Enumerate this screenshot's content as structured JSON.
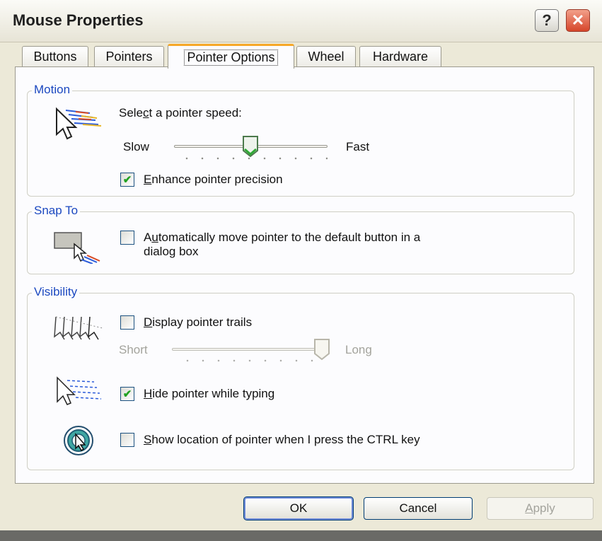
{
  "window": {
    "title": "Mouse Properties",
    "help_glyph": "?",
    "close_glyph": "✕"
  },
  "tabs": [
    {
      "label": "Buttons"
    },
    {
      "label": "Pointers"
    },
    {
      "label": "Pointer Options",
      "active": true
    },
    {
      "label": "Wheel"
    },
    {
      "label": "Hardware"
    }
  ],
  "motion": {
    "group_label": "Motion",
    "speed_label_a": "Sele",
    "speed_label_u": "c",
    "speed_label_b": "t a pointer speed:",
    "slow_label": "Slow",
    "fast_label": "Fast",
    "speed_level": 0.5,
    "precision_checked": true,
    "precision_u": "E",
    "precision_rest": "nhance pointer precision"
  },
  "snap": {
    "group_label": "Snap To",
    "checked": false,
    "label_a": "A",
    "label_u": "u",
    "label_b": "tomatically move pointer to the default button in a",
    "label_line2": "dialog box"
  },
  "visibility": {
    "group_label": "Visibility",
    "trails_checked": false,
    "trails_u": "D",
    "trails_rest": "isplay pointer trails",
    "short_label": "Short",
    "long_label": "Long",
    "trail_level": 1.0,
    "hide_checked": true,
    "hide_u": "H",
    "hide_rest": "ide pointer while typing",
    "show_checked": false,
    "show_u": "S",
    "show_rest": "how location of pointer when I press the CTRL key"
  },
  "buttons": {
    "ok": "OK",
    "cancel": "Cancel",
    "apply_u": "A",
    "apply_rest": "pply"
  },
  "colors": {
    "group_label": "#1b48c0",
    "tab_highlight": "#f6a828",
    "check": "#21a121",
    "close": "#d6452a"
  },
  "icons": [
    "help-icon",
    "close-icon",
    "pointer-speed-icon",
    "snap-to-icon",
    "pointer-trails-icon",
    "hide-pointer-icon",
    "show-location-icon",
    "slider-thumb-icon"
  ]
}
